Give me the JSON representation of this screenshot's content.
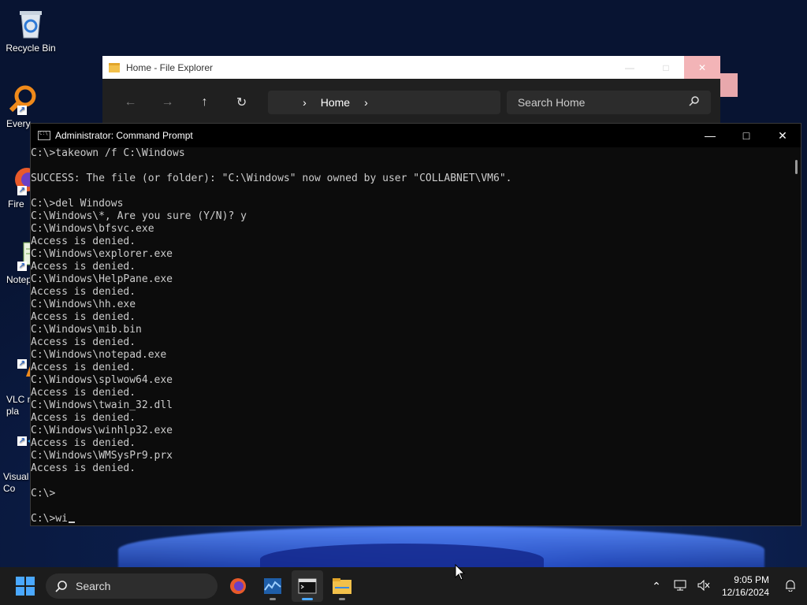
{
  "desktop": {
    "icons": [
      {
        "label": "Recycle Bin"
      },
      {
        "label": "Every"
      },
      {
        "label": "Fire"
      },
      {
        "label": "Notep"
      },
      {
        "label": "VLC m\npla"
      },
      {
        "label": "Visual\nCo"
      }
    ]
  },
  "explorer": {
    "title": "Home - File Explorer",
    "address_crumb": "Home",
    "search_placeholder": "Search Home"
  },
  "cmd": {
    "title": "Administrator: Command Prompt",
    "lines": [
      "C:\\>takeown /f C:\\Windows",
      "",
      "SUCCESS: The file (or folder): \"C:\\Windows\" now owned by user \"COLLABNET\\VM6\".",
      "",
      "C:\\>del Windows",
      "C:\\Windows\\*, Are you sure (Y/N)? y",
      "C:\\Windows\\bfsvc.exe",
      "Access is denied.",
      "C:\\Windows\\explorer.exe",
      "Access is denied.",
      "C:\\Windows\\HelpPane.exe",
      "Access is denied.",
      "C:\\Windows\\hh.exe",
      "Access is denied.",
      "C:\\Windows\\mib.bin",
      "Access is denied.",
      "C:\\Windows\\notepad.exe",
      "Access is denied.",
      "C:\\Windows\\splwow64.exe",
      "Access is denied.",
      "C:\\Windows\\twain_32.dll",
      "Access is denied.",
      "C:\\Windows\\winhlp32.exe",
      "Access is denied.",
      "C:\\Windows\\WMSysPr9.prx",
      "Access is denied.",
      "",
      "C:\\>",
      "",
      "C:\\>wi"
    ]
  },
  "taskbar": {
    "search_label": "Search",
    "time": "9:05 PM",
    "date": "12/16/2024"
  },
  "colors": {
    "accent": "#4aa8ff",
    "console_bg": "#0c0c0c",
    "console_fg": "#cccccc"
  }
}
